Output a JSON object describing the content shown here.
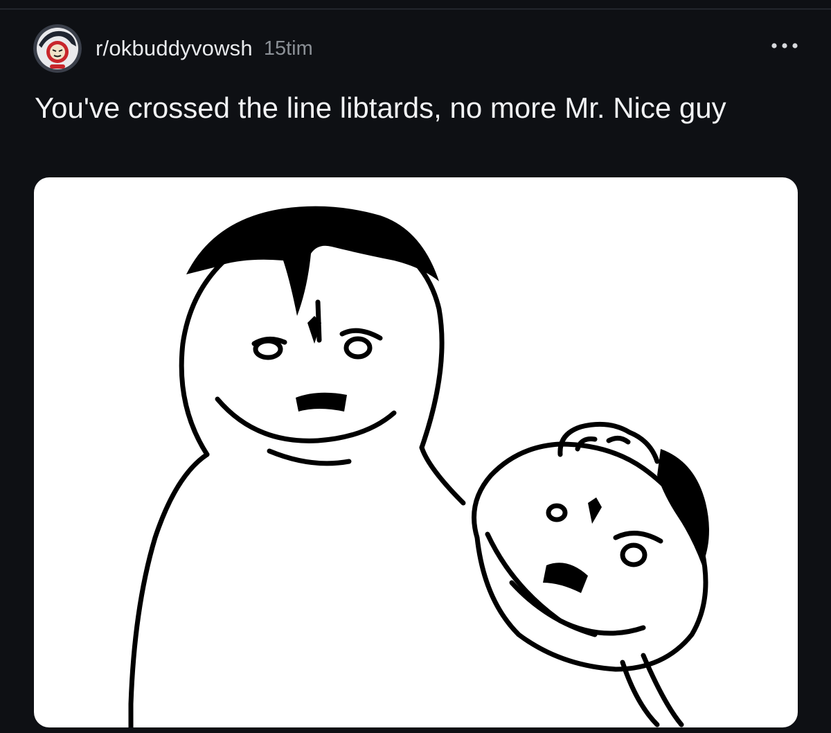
{
  "post": {
    "subreddit": "r/okbuddyvowsh",
    "age": "15tim",
    "title": "You've crossed the line libtards, no more Mr. Nice guy",
    "more_icon": "ellipsis-horizontal-icon",
    "avatar_icon": "subreddit-avatar",
    "image_description_icon": "rage-comic-meme-image"
  },
  "colors": {
    "background": "#0e1014",
    "text_primary": "#f2f3f5",
    "text_secondary": "#8b9096",
    "image_background": "#ffffff"
  }
}
